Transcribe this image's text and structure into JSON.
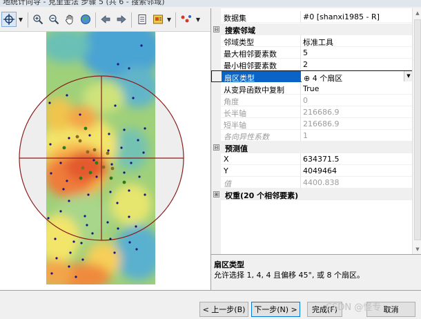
{
  "window": {
    "title": "地统计向导 - 克里金法 步骤 5 (共 6 - 搜索邻域)"
  },
  "toolbar": {
    "tools": [
      {
        "name": "pan-crosshair-tool",
        "selected": true
      },
      {
        "name": "zoom-in"
      },
      {
        "name": "zoom-out"
      },
      {
        "name": "pan-hand"
      },
      {
        "name": "full-extent-globe"
      },
      {
        "name": "back-arrow"
      },
      {
        "name": "forward-arrow"
      },
      {
        "name": "identify-table"
      },
      {
        "name": "layer-legend"
      },
      {
        "name": "points-symbol"
      }
    ]
  },
  "properties": {
    "dataset": {
      "label": "数据集",
      "value": "#0 [shanxi1985 - R]"
    },
    "search_neighborhood": {
      "header": "搜索邻域",
      "collapse_symbol": "⊟",
      "rows": [
        {
          "label": "邻域类型",
          "value": "标准工具"
        },
        {
          "label": "最大相邻要素数",
          "value": "5"
        },
        {
          "label": "最小相邻要素数",
          "value": "2"
        }
      ],
      "sector": {
        "label": "扇区类型",
        "symbol": "⊕",
        "value": "4 个扇区"
      },
      "copy_from": {
        "label": "从变异函数中复制",
        "value": "True"
      },
      "disabled_rows": [
        {
          "label": "角度",
          "value": "0"
        },
        {
          "label": "长半轴",
          "value": "216686.9"
        },
        {
          "label": "短半轴",
          "value": "216686.9"
        },
        {
          "label": "各向异性系数",
          "value": "1"
        }
      ]
    },
    "prediction": {
      "header": "预测值",
      "collapse_symbol": "⊟",
      "rows": [
        {
          "label": "X",
          "value": "634371.5"
        },
        {
          "label": "Y",
          "value": "4049464"
        }
      ],
      "value_row": {
        "label": "值",
        "value": "4400.838"
      }
    },
    "weights": {
      "header": "权重(20 个相邻要素)",
      "expand_symbol": "⊞"
    }
  },
  "help": {
    "title": "扇区类型",
    "body": "允许选择 1, 4, 4 且偏移 45°, 或 8 个扇区。"
  },
  "buttons": {
    "back": "< 上一步(B)",
    "next": "下一步(N) >",
    "finish": "完成(F)",
    "cancel": "取消"
  },
  "watermark": "CSDN @怪专",
  "map": {
    "colors": {
      "search_circle": "#8b1a1a",
      "point": "#141482",
      "neighbor_point": "#2a7a1a",
      "neighbor_point_brown": "#8a6a20",
      "hot": "#e35a2e",
      "cool": "#3d8fcf"
    }
  }
}
